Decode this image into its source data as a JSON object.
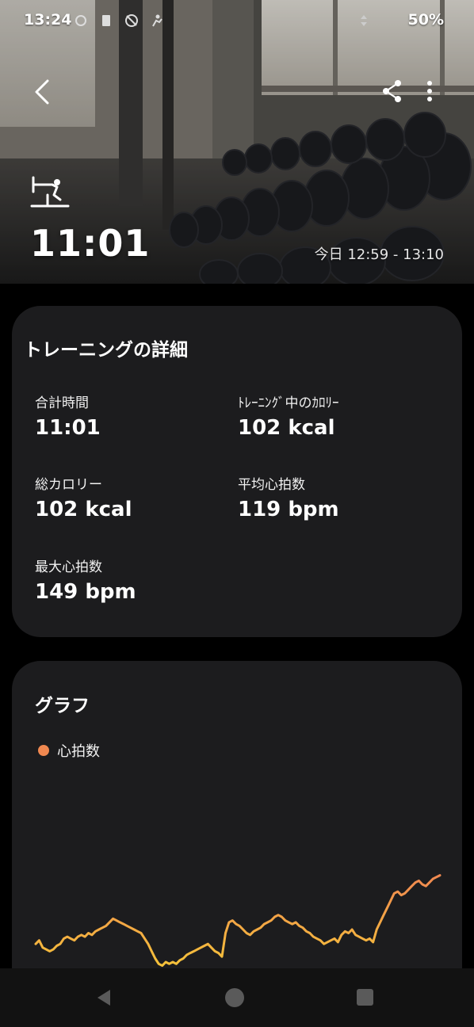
{
  "status_bar": {
    "time": "13:24",
    "battery": "50%",
    "icons": [
      "sync-icon",
      "sim-icon",
      "no-signal-icon",
      "activity-icon"
    ]
  },
  "hero": {
    "duration": "11:01",
    "time_range": "今日 12:59 - 13:10",
    "exercise_icon": "rowing-machine-icon"
  },
  "details": {
    "title": "トレーニングの詳細",
    "metrics": [
      {
        "label": "合計時間",
        "value": "11:01"
      },
      {
        "label": "ﾄﾚｰﾆﾝｸﾞ中のｶﾛﾘｰ",
        "value": "102 kcal"
      },
      {
        "label": "総カロリー",
        "value": "102 kcal"
      },
      {
        "label": "平均心拍数",
        "value": "119 bpm"
      },
      {
        "label": "最大心拍数",
        "value": "149 bpm"
      }
    ]
  },
  "graph": {
    "title": "グラフ",
    "legend": "心拍数",
    "colors": {
      "series_low": "#f5c23a",
      "series_high": "#f08850"
    }
  },
  "chart_data": {
    "type": "line",
    "series": [
      {
        "name": "心拍数",
        "values": [
          112,
          114,
          110,
          109,
          108,
          109,
          111,
          112,
          115,
          116,
          115,
          114,
          116,
          117,
          116,
          118,
          117,
          119,
          120,
          121,
          122,
          124,
          126,
          125,
          124,
          123,
          122,
          121,
          120,
          119,
          118,
          115,
          112,
          108,
          104,
          101,
          100,
          102,
          101,
          102,
          101,
          103,
          104,
          106,
          107,
          108,
          109,
          110,
          111,
          112,
          110,
          108,
          107,
          105,
          118,
          124,
          125,
          123,
          122,
          120,
          118,
          117,
          119,
          120,
          121,
          123,
          124,
          125,
          127,
          128,
          127,
          125,
          124,
          123,
          124,
          122,
          121,
          119,
          118,
          116,
          115,
          114,
          112,
          113,
          114,
          115,
          113,
          117,
          119,
          118,
          120,
          117,
          116,
          115,
          114,
          115,
          113,
          120,
          124,
          128,
          132,
          136,
          140,
          141,
          139,
          140,
          142,
          144,
          146,
          147,
          145,
          144,
          146,
          148,
          149,
          150
        ]
      }
    ]
  }
}
